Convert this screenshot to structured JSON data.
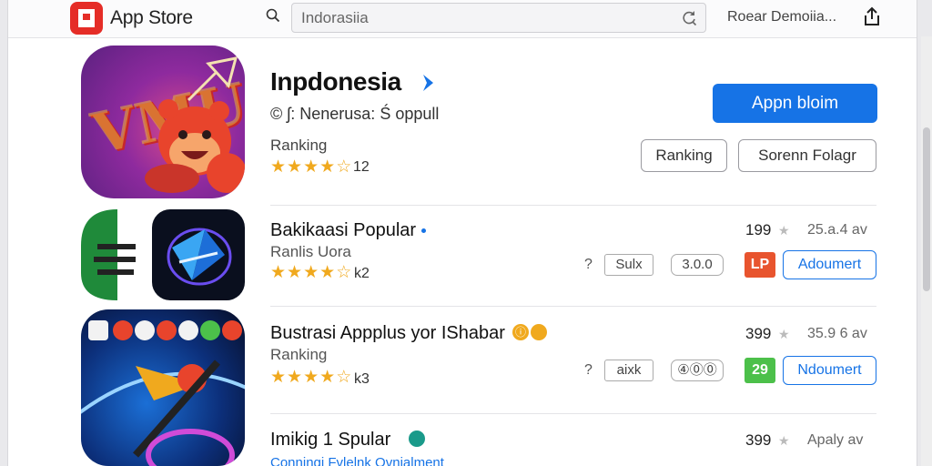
{
  "app": {
    "brand": "App Store",
    "colors": {
      "accent": "#1673e6",
      "brand": "#e52d27",
      "star": "#f0a91e"
    }
  },
  "search": {
    "value": "Indorasiia"
  },
  "header": {
    "user_name": "Roear Demoiia..."
  },
  "featured": {
    "title": "Inpdonesia",
    "subtitle": "© ʃ: Nenerusa: Ś oppull",
    "rank_label": "Ranking",
    "rating": 4.5,
    "rating_count": "12",
    "primary_button": "Appn bloim",
    "secondary_buttons": [
      "Ranking",
      "Sorenn Folagr"
    ]
  },
  "rows": [
    {
      "title": "Bakikaasi Popular",
      "subtitle": "Ranlis Uora",
      "rating": 4.5,
      "rating_count": "k2",
      "question": "?",
      "chip_text": "Sulx",
      "chip_round": "3.0.0",
      "tag_text": "LP",
      "tag_color": "#e8542e",
      "count": "199",
      "meta": "25.a.4 av",
      "button": "Adoumert"
    },
    {
      "title": "Bustrasi Appplus yor IShabar",
      "subtitle": "Ranking",
      "rating": 4.5,
      "rating_count": "k3",
      "question": "?",
      "chip_text": "aixk",
      "chip_round": "④⓪⓪",
      "tag_text": "29",
      "tag_color": "#4cc04a",
      "count": "399",
      "meta": "35.9 6 av",
      "button": "Ndoumert"
    },
    {
      "title": "Imikig 1 Spular",
      "subtitle": "Conningi Fvlelnk Ovnialment",
      "count": "399",
      "meta": "Apaly av"
    }
  ],
  "icons": {
    "search": "search-icon",
    "refresh": "refresh-icon",
    "share": "share-icon",
    "verified": "verified-badge-icon"
  }
}
